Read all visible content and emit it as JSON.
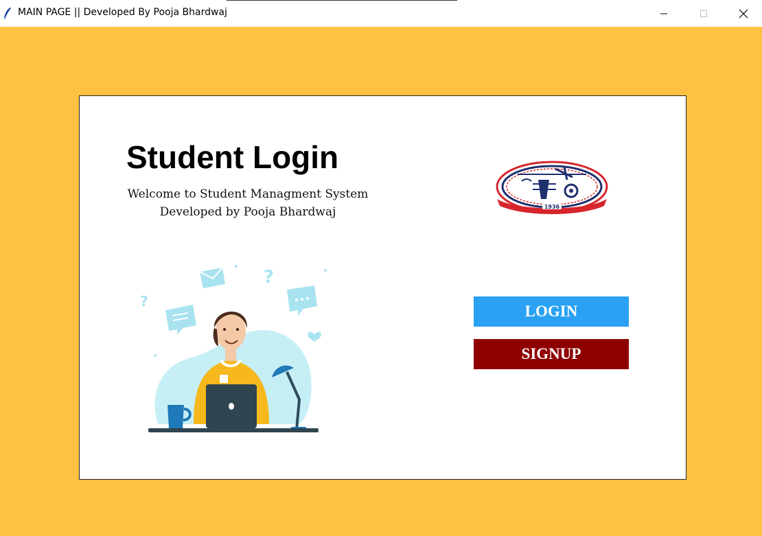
{
  "window": {
    "title": "MAIN PAGE || Developed By Pooja Bhardwaj",
    "controls": [
      "minimize-icon",
      "maximize-icon",
      "close-icon"
    ]
  },
  "colors": {
    "background": "#ffc143",
    "card": "#ffffff",
    "login_button": "#2aa1f2",
    "signup_button": "#8e0000",
    "logo_red": "#d6262c",
    "logo_navy": "#1f2f6e"
  },
  "main": {
    "heading": "Student Login",
    "subtitle_line1": "Welcome to Student Managment System",
    "subtitle_line2": "Developed by Pooja Bhardwaj",
    "logo": {
      "icon": "college-logo-icon",
      "year": "1936"
    },
    "illustration": {
      "icon": "student-at-laptop-illustration"
    },
    "buttons": {
      "login_label": "LOGIN",
      "signup_label": "SIGNUP"
    }
  }
}
